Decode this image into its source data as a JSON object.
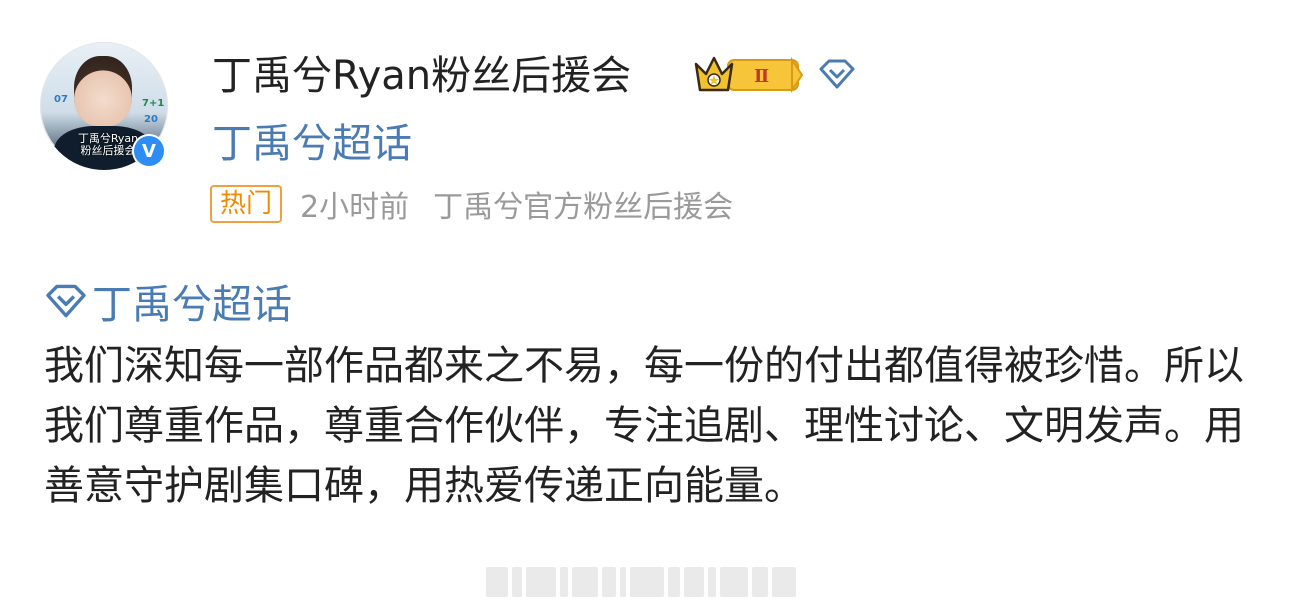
{
  "post": {
    "author_name": "丁禹兮Ryan粉丝后援会",
    "badge_level": "Ⅱ",
    "super_topic_source": "丁禹兮超话",
    "meta": {
      "hot_tag": "热门",
      "time": "2小时前",
      "source": "丁禹兮官方粉丝后援会"
    },
    "topic_link": "丁禹兮超话",
    "body": "我们深知每一部作品都来之不易，每一份的付出都值得被珍惜。所以我们尊重作品，尊重合作伙伴，专注追剧、理性讨论、文明发声。用善意守护剧集口碑，用热爱传递正向能量。"
  },
  "avatar": {
    "caption_line1": "丁禹兮Ryan",
    "caption_line2": "粉丝后援会",
    "deco_a": "07",
    "deco_b": "20",
    "deco_c": "7+1"
  },
  "colors": {
    "link_blue": "#4a7bb3",
    "hot_orange": "#f08a00",
    "verified_blue": "#2e8df5",
    "crown_gold": "#f2c12e"
  },
  "icons": {
    "verified": "verified-v-icon",
    "crown": "crown-badge-icon",
    "diamond": "super-topic-diamond-icon"
  }
}
